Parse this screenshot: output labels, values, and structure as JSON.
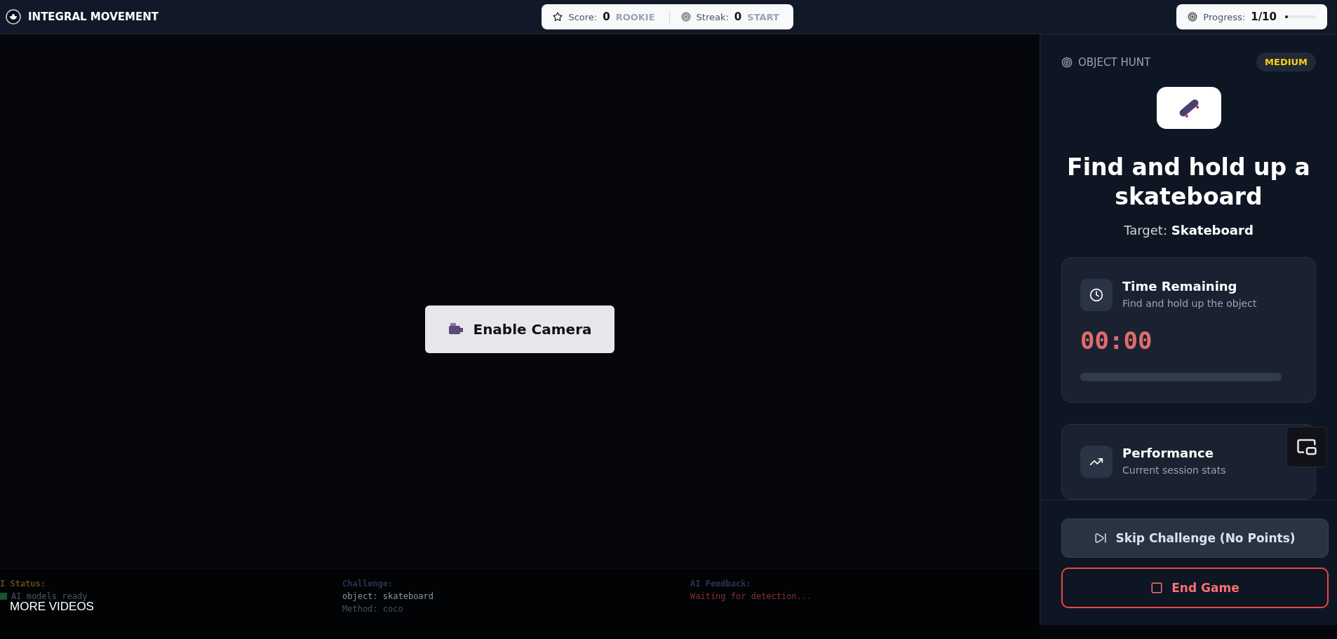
{
  "header": {
    "brand": "INTEGRAL MOVEMENT",
    "score": {
      "label": "Score:",
      "value": "0",
      "rank": "ROOKIE"
    },
    "streak": {
      "label": "Streak:",
      "value": "0",
      "rank": "START"
    },
    "progress": {
      "label": "Progress:",
      "value": "1/10",
      "level": 0.1
    }
  },
  "camera": {
    "button": "Enable Camera"
  },
  "status_strip": {
    "columns": [
      {
        "title": "I Status:",
        "lines": [
          {
            "text": "AI models ready",
            "kind": "ready"
          }
        ]
      },
      {
        "title": "Challenge:",
        "lines": [
          {
            "text": "object: skateboard",
            "kind": "plain"
          },
          {
            "text": "Method: coco",
            "kind": "dim"
          }
        ]
      },
      {
        "title": "AI Feedback:",
        "lines": [
          {
            "text": "Waiting for detection...",
            "kind": "alert"
          }
        ]
      }
    ],
    "overlay": "MORE VIDEOS"
  },
  "panel": {
    "mode": "OBJECT HUNT",
    "difficulty": "MEDIUM",
    "title": "Find and hold up a skateboard",
    "target_label": "Target:",
    "target": "Skateboard",
    "cards": [
      {
        "kind": "timer",
        "title": "Time Remaining",
        "subtitle": "Find and hold up the object",
        "time": "00:00"
      },
      {
        "kind": "stats",
        "title": "Performance",
        "subtitle": "Current session stats"
      }
    ],
    "buttons": [
      {
        "kind": "skip",
        "label": "Skip Challenge (No Points)"
      },
      {
        "kind": "end",
        "label": "End Game"
      }
    ]
  }
}
